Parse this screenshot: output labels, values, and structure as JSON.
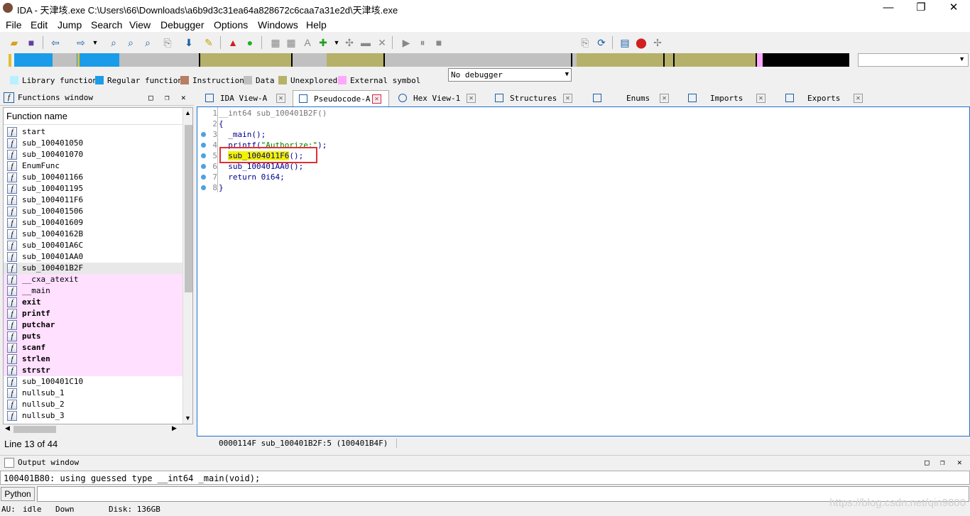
{
  "window": {
    "title": "IDA - 天津垓.exe C:\\Users\\66\\Downloads\\a6b9d3c31ea64a828672c6caa7a31e2d\\天津垓.exe",
    "minimize": "—",
    "maximize": "❐",
    "close": "✕"
  },
  "menu": [
    "File",
    "Edit",
    "Jump",
    "Search",
    "View",
    "Debugger",
    "Options",
    "Windows",
    "Help"
  ],
  "toolbar": {
    "debugger_select": "No debugger"
  },
  "legend": [
    {
      "label": "Library function",
      "color": "#b7f0ff"
    },
    {
      "label": "Regular function",
      "color": "#1a9ce8"
    },
    {
      "label": "Instruction",
      "color": "#b87d62"
    },
    {
      "label": "Data",
      "color": "#c0c0c0"
    },
    {
      "label": "Unexplored",
      "color": "#b6b16a"
    },
    {
      "label": "External symbol",
      "color": "#ffa8ff"
    }
  ],
  "functions_window": {
    "title": "Functions window",
    "column_header": "Function name",
    "items": [
      {
        "name": "start",
        "kind": "regular"
      },
      {
        "name": "sub_100401050",
        "kind": "regular"
      },
      {
        "name": "sub_100401070",
        "kind": "regular"
      },
      {
        "name": "EnumFunc",
        "kind": "regular"
      },
      {
        "name": "sub_100401166",
        "kind": "regular"
      },
      {
        "name": "sub_100401195",
        "kind": "regular"
      },
      {
        "name": "sub_1004011F6",
        "kind": "regular"
      },
      {
        "name": "sub_100401506",
        "kind": "regular"
      },
      {
        "name": "sub_100401609",
        "kind": "regular"
      },
      {
        "name": "sub_10040162B",
        "kind": "regular"
      },
      {
        "name": "sub_100401A6C",
        "kind": "regular"
      },
      {
        "name": "sub_100401AA0",
        "kind": "regular"
      },
      {
        "name": "sub_100401B2F",
        "kind": "selected"
      },
      {
        "name": "__cxa_atexit",
        "kind": "external"
      },
      {
        "name": "__main",
        "kind": "external"
      },
      {
        "name": "exit",
        "kind": "external-bold"
      },
      {
        "name": "printf",
        "kind": "external-bold"
      },
      {
        "name": "putchar",
        "kind": "external-bold"
      },
      {
        "name": "puts",
        "kind": "external-bold"
      },
      {
        "name": "scanf",
        "kind": "external-bold"
      },
      {
        "name": "strlen",
        "kind": "external-bold"
      },
      {
        "name": "strstr",
        "kind": "external-bold"
      },
      {
        "name": "sub_100401C10",
        "kind": "regular"
      },
      {
        "name": "nullsub_1",
        "kind": "regular"
      },
      {
        "name": "nullsub_2",
        "kind": "regular"
      },
      {
        "name": "nullsub_3",
        "kind": "regular"
      }
    ],
    "line_status": "Line 13 of 44"
  },
  "tabs": [
    {
      "label": "IDA View-A"
    },
    {
      "label": "Pseudocode-A"
    },
    {
      "label": "Hex View-1"
    },
    {
      "label": "Structures"
    },
    {
      "label": "Enums"
    },
    {
      "label": "Imports"
    },
    {
      "label": "Exports"
    }
  ],
  "pseudocode": {
    "header": "__int64 sub_100401B2F()",
    "open_brace": "{",
    "lines": [
      {
        "n": "1",
        "text": "__int64 sub_100401B2F()"
      },
      {
        "n": "2",
        "text": "{"
      },
      {
        "n": "3",
        "text": "  _main();"
      },
      {
        "n": "4",
        "pre": "  printf(",
        "str": "\"Authorize:\"",
        "post": ");"
      },
      {
        "n": "5",
        "hl": "sub_1004011F6",
        "post": "();"
      },
      {
        "n": "6",
        "text": "  sub_100401AA0();"
      },
      {
        "n": "7",
        "text": "  return 0i64;"
      },
      {
        "n": "8",
        "text": "}"
      }
    ],
    "status": "0000114F sub_100401B2F:5 (100401B4F)"
  },
  "output_window": {
    "title": "Output window",
    "text": "100401B80: using guessed type __int64 _main(void);",
    "python_button": "Python"
  },
  "statusbar": {
    "au_label": "AU:",
    "au_state": "idle",
    "direction": "Down",
    "disk": "Disk: 136GB"
  },
  "watermark": "https://blog.csdn.net/qin9800"
}
